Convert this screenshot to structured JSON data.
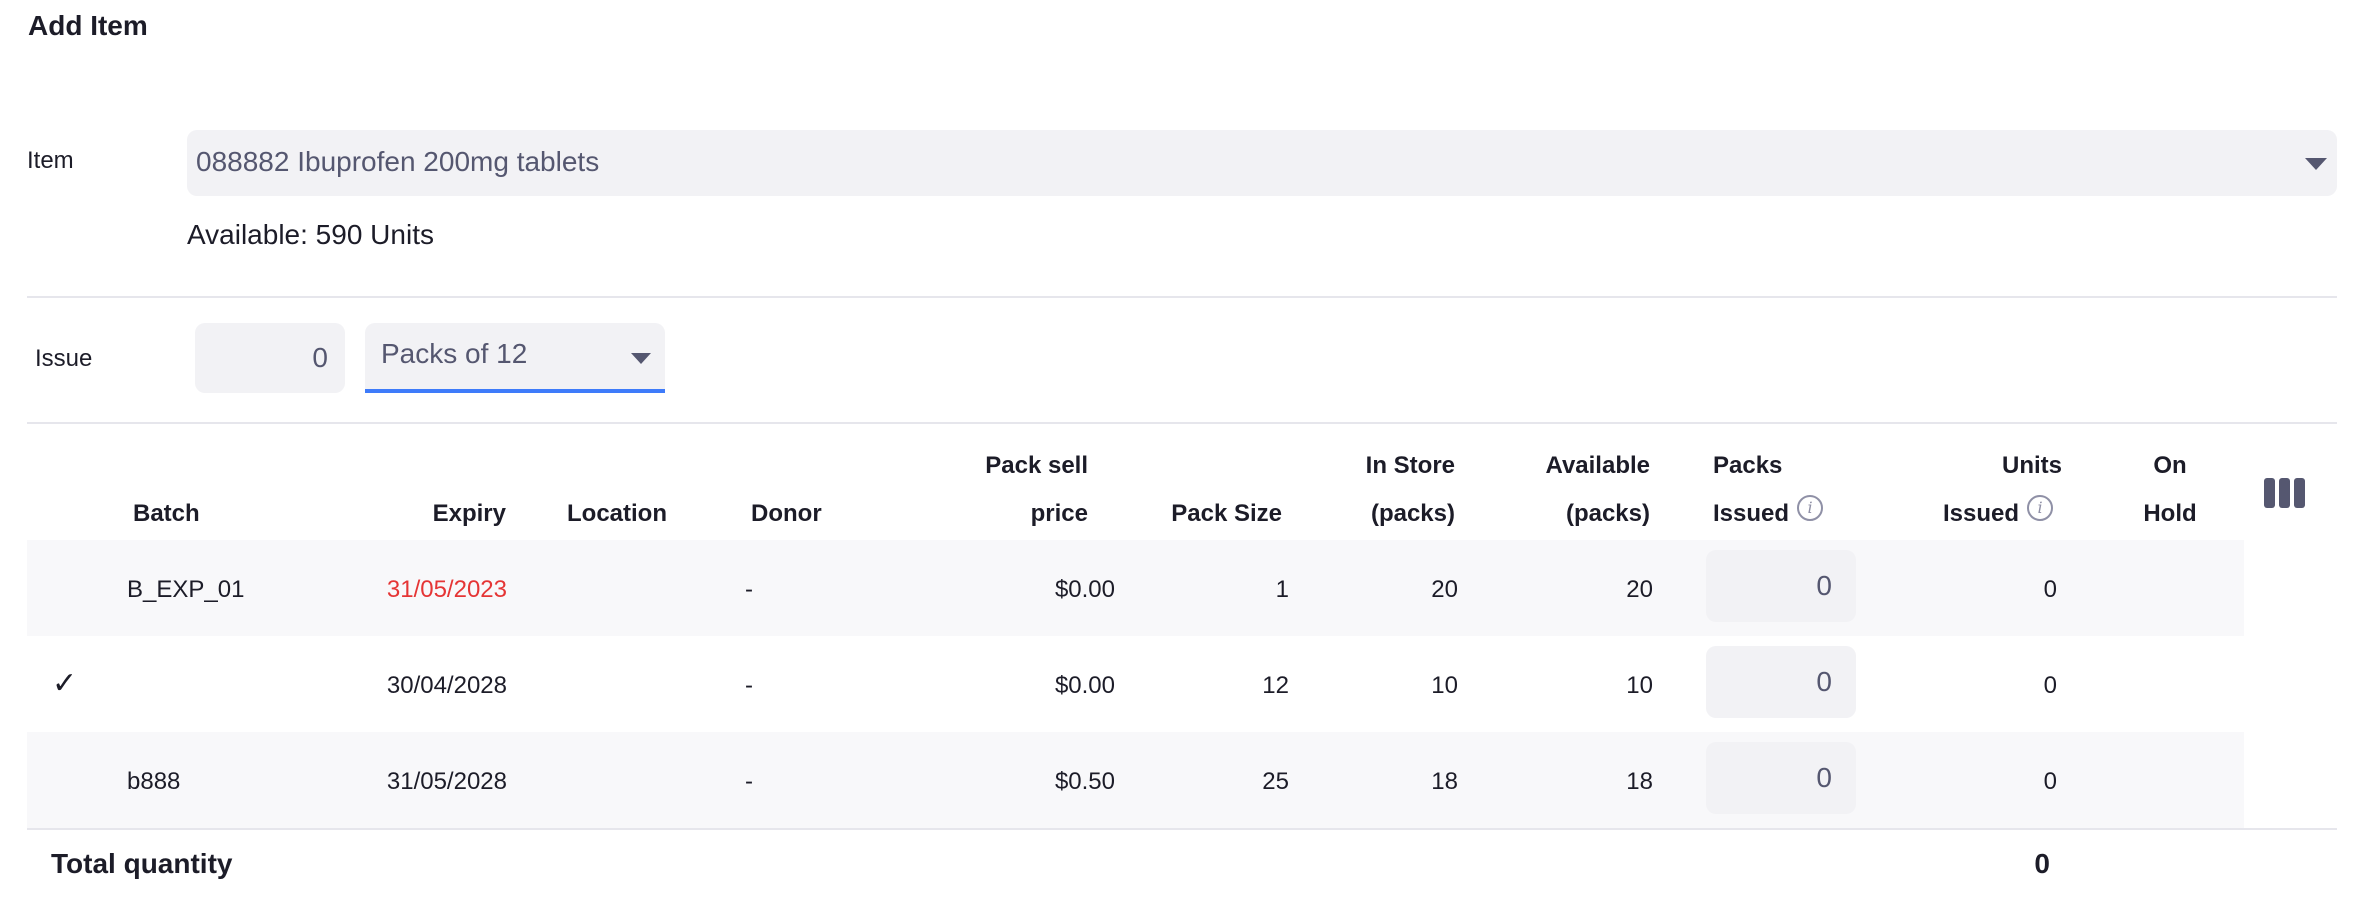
{
  "title": "Add Item",
  "item": {
    "label": "Item",
    "value": "088882 Ibuprofen 200mg tablets",
    "available": "Available: 590 Units"
  },
  "issue": {
    "label": "Issue",
    "quantity": "0",
    "pack_option": "Packs of 12"
  },
  "table": {
    "headers": {
      "batch": "Batch",
      "expiry": "Expiry",
      "location": "Location",
      "donor": "Donor",
      "pack_sell_price_1": "Pack sell",
      "pack_sell_price_2": "price",
      "pack_size": "Pack Size",
      "in_store_1": "In Store",
      "in_store_2": "(packs)",
      "available_1": "Available",
      "available_2": "(packs)",
      "packs_issued_1": "Packs",
      "packs_issued_2": "Issued",
      "units_issued_1": "Units",
      "units_issued_2": "Issued",
      "on_hold_1": "On",
      "on_hold_2": "Hold"
    },
    "rows": [
      {
        "check": "",
        "batch": "B_EXP_01",
        "expiry": "31/05/2023",
        "expired": true,
        "location": "",
        "donor": "-",
        "price": "$0.00",
        "pack_size": "1",
        "in_store": "20",
        "available": "20",
        "packs_issued": "0",
        "units_issued": "0"
      },
      {
        "check": "✓",
        "batch": "",
        "expiry": "30/04/2028",
        "expired": false,
        "location": "",
        "donor": "-",
        "price": "$0.00",
        "pack_size": "12",
        "in_store": "10",
        "available": "10",
        "packs_issued": "0",
        "units_issued": "0"
      },
      {
        "check": "",
        "batch": "b888",
        "expiry": "31/05/2028",
        "expired": false,
        "location": "",
        "donor": "-",
        "price": "$0.50",
        "pack_size": "25",
        "in_store": "18",
        "available": "18",
        "packs_issued": "0",
        "units_issued": "0"
      }
    ],
    "total_label": "Total quantity",
    "total_value": "0"
  },
  "colors": {
    "accent": "#3e7bfa",
    "expired": "#e53535"
  },
  "icons": {
    "info": "info-icon",
    "columns": "columns-icon",
    "dropdown": "chevron-down-icon"
  }
}
